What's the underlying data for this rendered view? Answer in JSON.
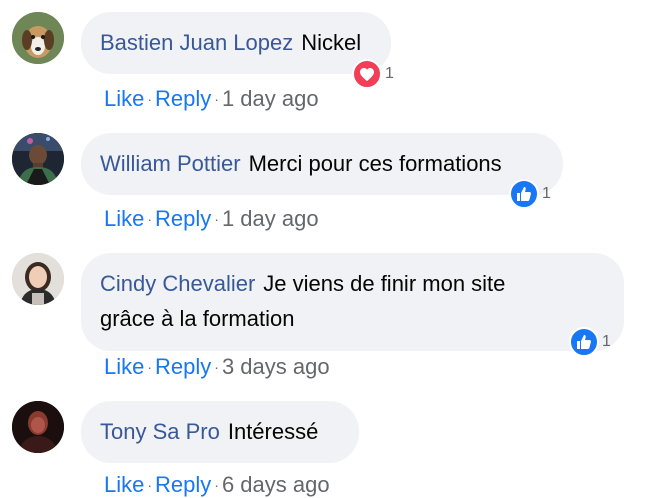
{
  "colors": {
    "author": "#385898",
    "link": "#1877f2",
    "meta": "#65676b",
    "bubble": "#f0f2f5",
    "love": "#f33e58",
    "like": "#1877f2"
  },
  "actions": {
    "like_label": "Like",
    "reply_label": "Reply",
    "separator": "·"
  },
  "comments": [
    {
      "author": "Bastien Juan Lopez",
      "text": "Nickel",
      "reaction_icon": "heart-icon",
      "reaction_count": "1",
      "time": "1 day ago"
    },
    {
      "author": "William Pottier",
      "text": "Merci pour ces formations",
      "reaction_icon": "thumbs-up-icon",
      "reaction_count": "1",
      "time": "1 day ago"
    },
    {
      "author": "Cindy Chevalier",
      "text": "Je viens de finir mon site",
      "text_line2": "grâce à la formation",
      "reaction_icon": "thumbs-up-icon",
      "reaction_count": "1",
      "time": "3 days ago"
    },
    {
      "author": "Tony Sa Pro",
      "text": "Intéressé",
      "time": "6 days ago"
    }
  ]
}
